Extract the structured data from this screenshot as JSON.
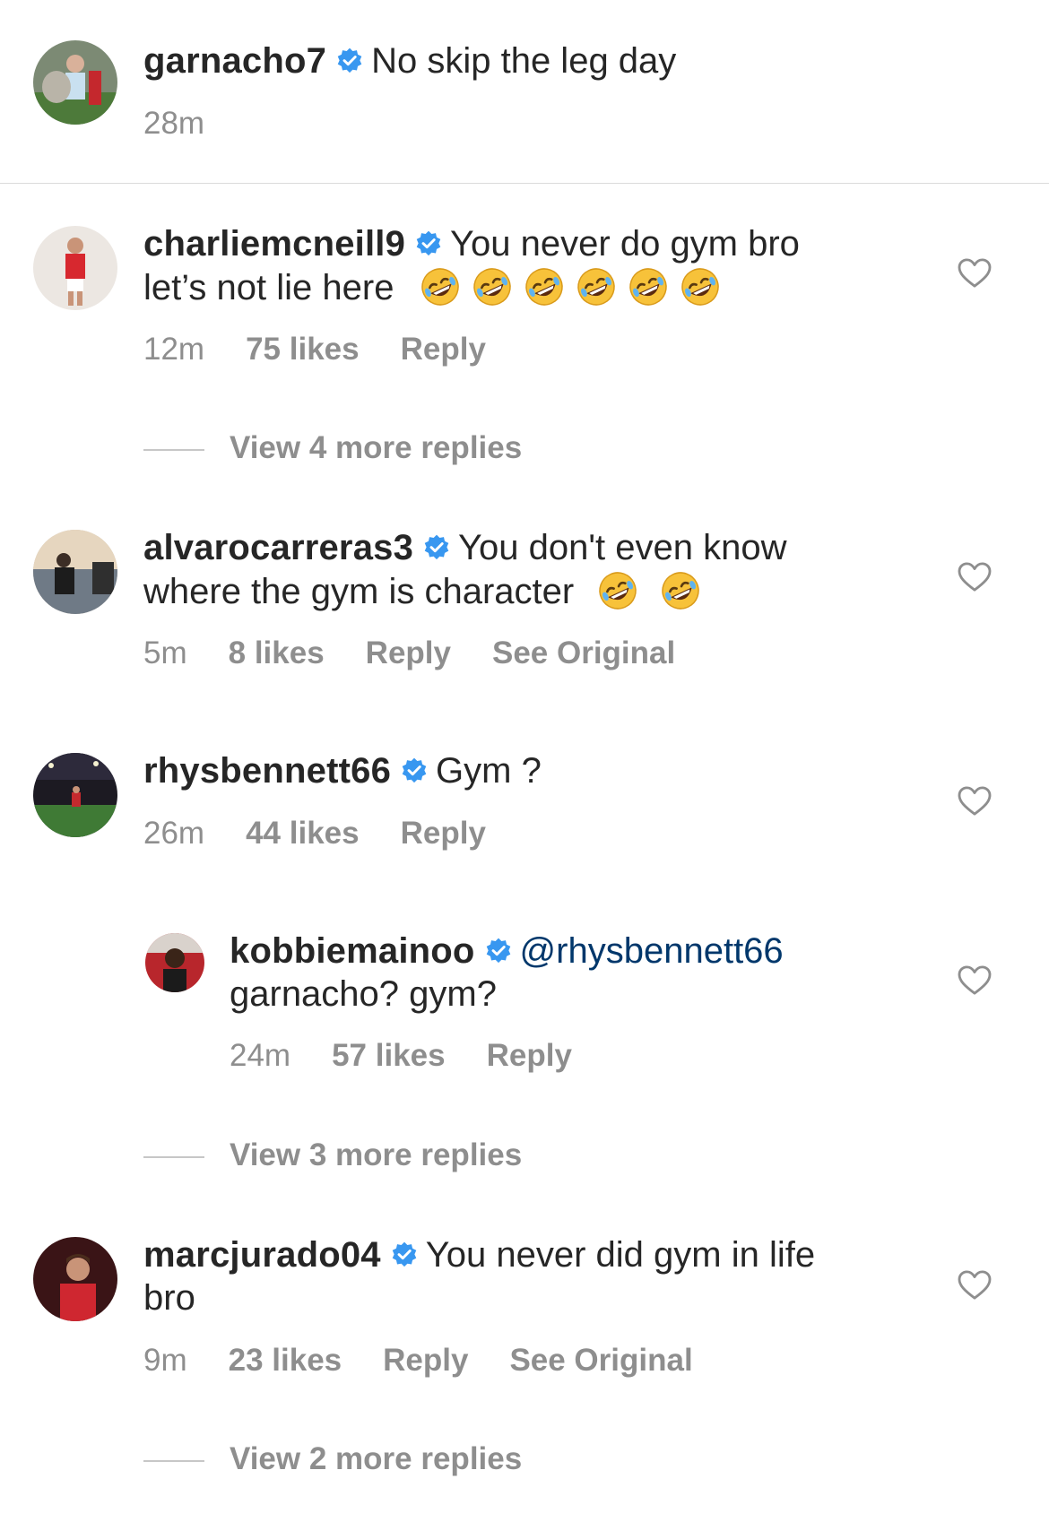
{
  "caption": {
    "username": "garnacho7",
    "text": "No skip the leg day",
    "time": "28m"
  },
  "comments": [
    {
      "username": "charliemcneill9",
      "text_line1": "You never do gym bro",
      "text_line2": "let’s not lie here",
      "time": "12m",
      "likes": "75 likes",
      "reply": "Reply",
      "view_more": "View 4 more replies"
    },
    {
      "username": "alvarocarreras3",
      "text_line1": "You don't even know",
      "text_line2": "where the gym is character",
      "time": "5m",
      "likes": "8 likes",
      "reply": "Reply",
      "see_original": "See Original"
    },
    {
      "username": "rhysbennett66",
      "text_line1": "Gym ?",
      "time": "26m",
      "likes": "44 likes",
      "reply": "Reply"
    },
    {
      "username": "kobbiemainoo",
      "mention": "@rhysbennett66",
      "text_line2": "garnacho? gym?",
      "time": "24m",
      "likes": "57 likes",
      "reply": "Reply",
      "view_more": "View 3 more replies"
    },
    {
      "username": "marcjurado04",
      "text_line1": "You never did gym in life",
      "text_line2": "bro",
      "time": "9m",
      "likes": "23 likes",
      "reply": "Reply",
      "see_original": "See Original",
      "view_more": "View 2 more replies"
    }
  ],
  "icons": {
    "verified": "verified-badge-icon",
    "heart": "heart-outline-icon",
    "emoji": "rolling-on-floor-laughing-emoji"
  },
  "colors": {
    "verified": "#3897f0",
    "meta_text": "#8e8e8e",
    "mention": "#00376b"
  }
}
